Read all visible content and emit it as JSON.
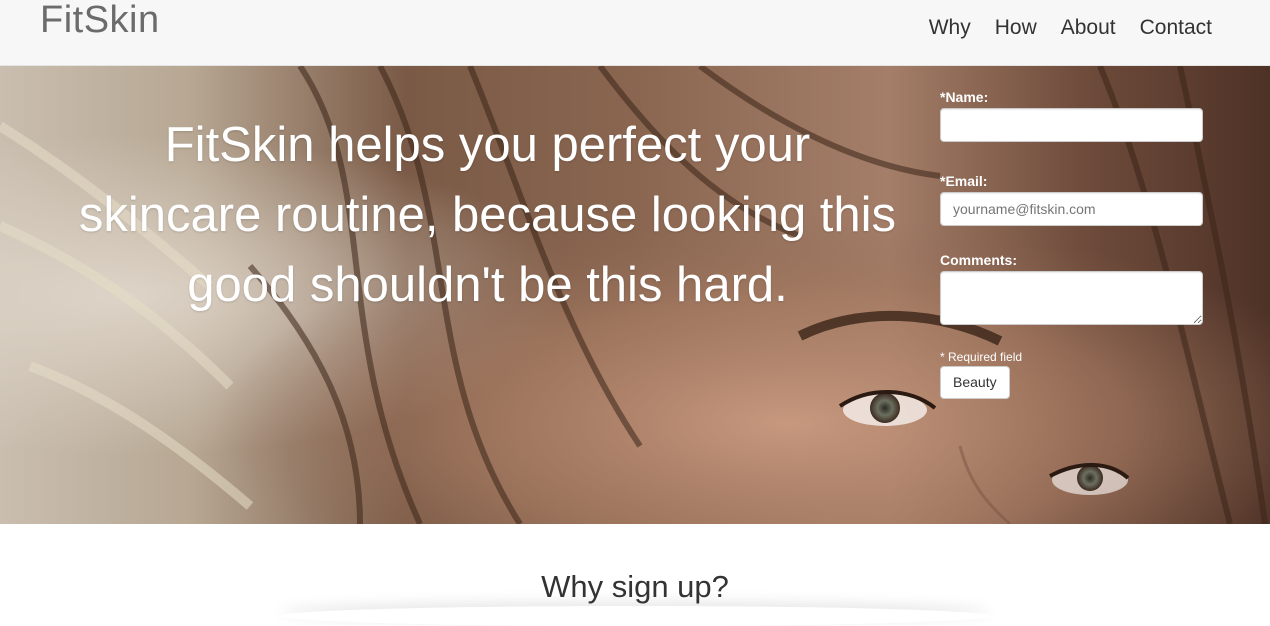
{
  "navbar": {
    "brand": "FitSkin",
    "links": [
      "Why",
      "How",
      "About",
      "Contact"
    ]
  },
  "hero": {
    "headline": "FitSkin helps you perfect your skincare routine, because looking this good shouldn't be this hard."
  },
  "form": {
    "name_label": "*Name:",
    "name_value": "",
    "email_label": "*Email:",
    "email_placeholder": "yourname@fitskin.com",
    "comments_label": "Comments:",
    "comments_value": "",
    "required_note": "* Required field",
    "submit_label": "Beauty"
  },
  "section": {
    "title": "Why sign up?"
  },
  "colors": {
    "navbar_bg": "#f7f7f7",
    "brand_color": "#6b6b6b",
    "hero_text": "#ffffff"
  }
}
